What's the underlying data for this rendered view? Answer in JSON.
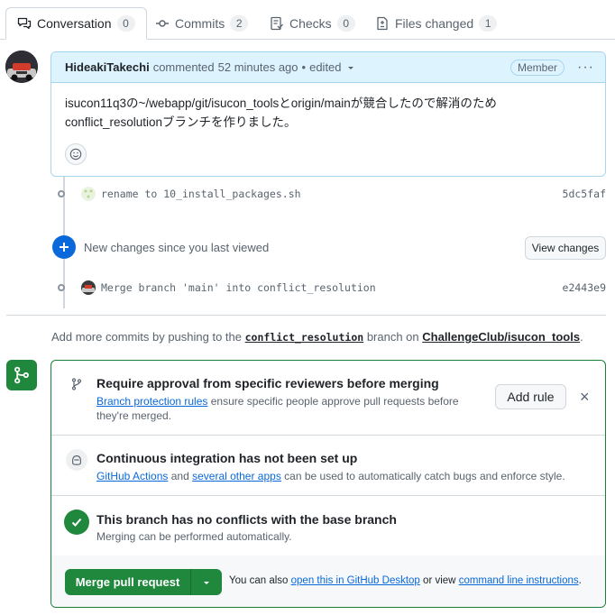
{
  "tabs": [
    {
      "label": "Conversation",
      "count": "0",
      "icon": "comment-discussion-icon"
    },
    {
      "label": "Commits",
      "count": "2",
      "icon": "git-commit-icon"
    },
    {
      "label": "Checks",
      "count": "0",
      "icon": "checklist-icon"
    },
    {
      "label": "Files changed",
      "count": "1",
      "icon": "file-diff-icon"
    }
  ],
  "comment": {
    "author": "HideakiTakechi",
    "action": "commented",
    "time": "52 minutes ago",
    "sep": "•",
    "edited": "edited",
    "role": "Member",
    "body": "isucon11q3の~/webapp/git/isucon_toolsとorigin/mainが競合したので解消のためconflict_resolutionブランチを作りました。"
  },
  "commits": [
    {
      "message": "rename to 10_install_packages.sh",
      "sha": "5dc5faf"
    },
    {
      "message": "Merge branch 'main' into conflict_resolution",
      "sha": "e2443e9"
    }
  ],
  "new_changes": {
    "label": "New changes since you last viewed",
    "button": "View changes"
  },
  "push_hint": {
    "prefix": "Add more commits by pushing to the",
    "branch": "conflict_resolution",
    "middle": "branch on",
    "repo": "ChallengeClub/isucon_tools",
    "suffix": "."
  },
  "merge": {
    "approval": {
      "title": "Require approval from specific reviewers before merging",
      "link": "Branch protection rules",
      "text_line1": "ensure specific people approve pull requests before",
      "text_line2": "they're merged.",
      "button": "Add rule",
      "close": "×"
    },
    "ci": {
      "title": "Continuous integration has not been set up",
      "link1": "GitHub Actions",
      "and": "and",
      "link2": "several other apps",
      "text": "can be used to automatically catch bugs and enforce style."
    },
    "conflicts": {
      "title": "This branch has no conflicts with the base branch",
      "sub": "Merging can be performed automatically."
    },
    "button": "Merge pull request",
    "also": "You can also",
    "desktop_link": "open this in GitHub Desktop",
    "or_view": "or view",
    "cli_link": "command line instructions",
    "end": "."
  },
  "colors": {
    "accent": "#0969da",
    "success": "#1f883d",
    "highlight": "#ddf4ff"
  }
}
